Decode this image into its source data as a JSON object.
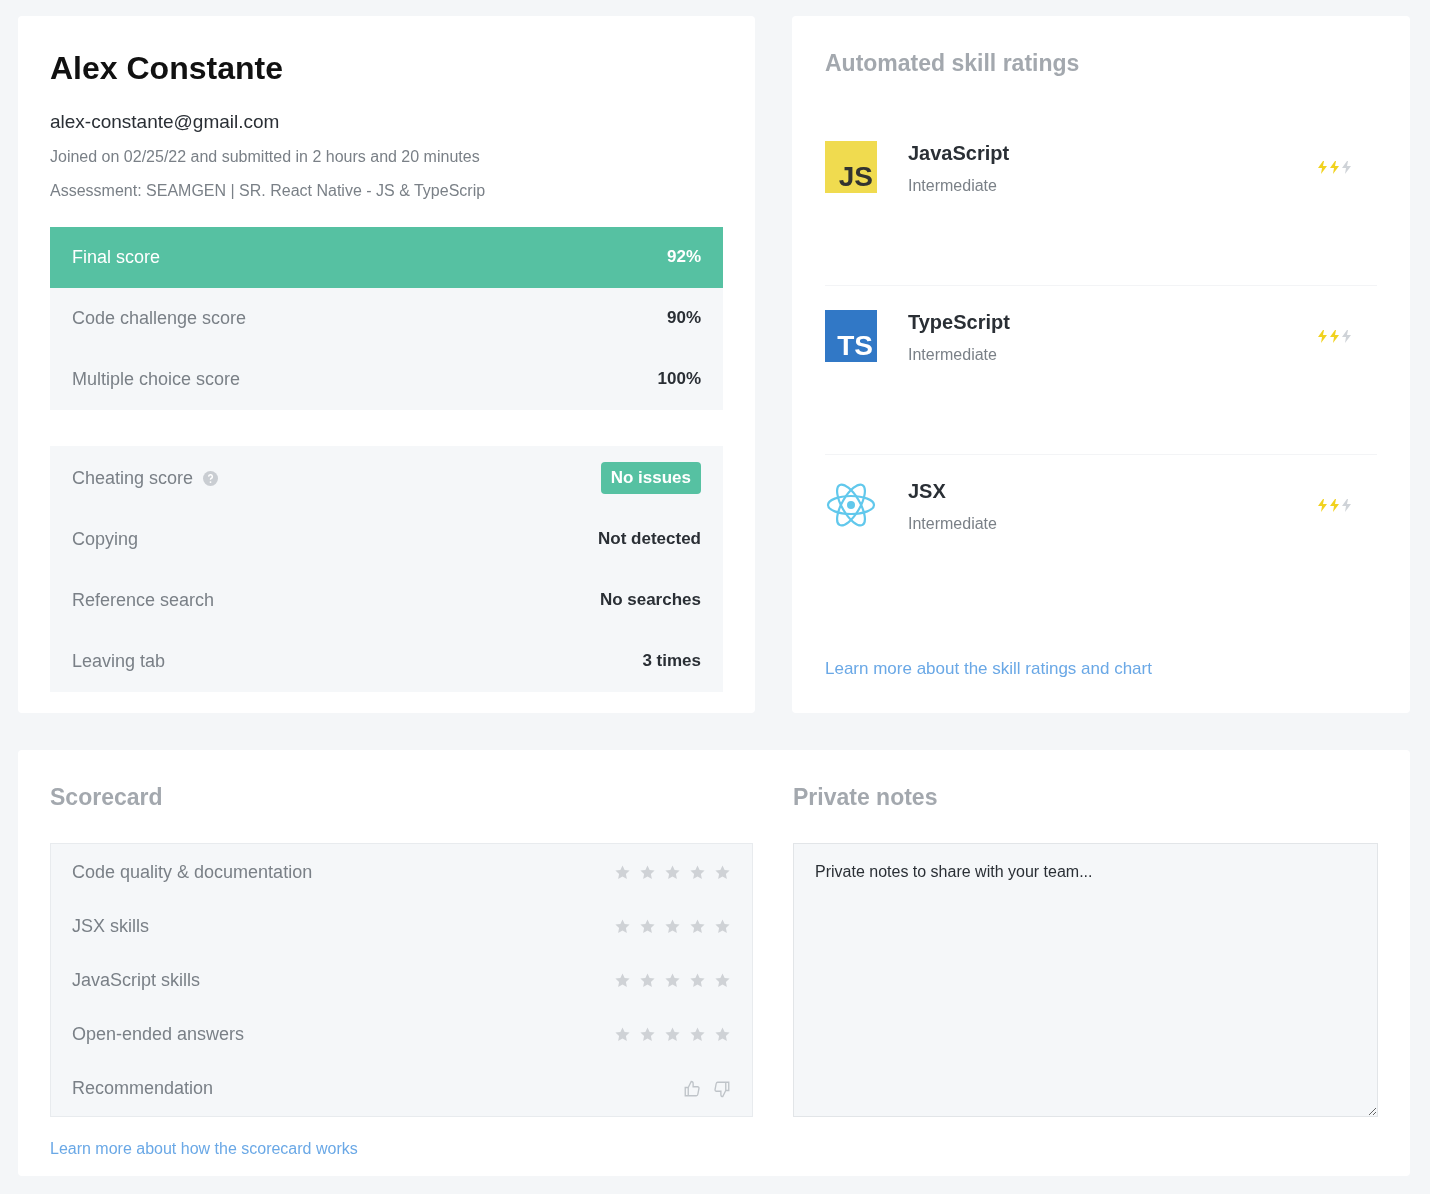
{
  "profile": {
    "name": "Alex Constante",
    "email": "alex-constante@gmail.com",
    "joined": "Joined on 02/25/22 and submitted in 2 hours and 20 minutes",
    "assessment": "Assessment: SEAMGEN | SR. React Native - JS & TypeScrip"
  },
  "scores": [
    {
      "label": "Final score",
      "value": "92%",
      "selected": true
    },
    {
      "label": "Code challenge score",
      "value": "90%",
      "selected": false
    },
    {
      "label": "Multiple choice score",
      "value": "100%",
      "selected": false
    }
  ],
  "cheating": {
    "label": "Cheating score",
    "badge": "No issues",
    "rows": [
      {
        "label": "Copying",
        "value": "Not detected"
      },
      {
        "label": "Reference search",
        "value": "No searches"
      },
      {
        "label": "Leaving tab",
        "value": "3 times"
      }
    ]
  },
  "skills": {
    "title": "Automated skill ratings",
    "items": [
      {
        "kind": "js",
        "logo": "JS",
        "name": "JavaScript",
        "level_text": "Intermediate",
        "stars": 2
      },
      {
        "kind": "ts",
        "logo": "TS",
        "name": "TypeScript",
        "level_text": "Intermediate",
        "stars": 2
      },
      {
        "kind": "react",
        "name": "JSX",
        "level_text": "Intermediate",
        "stars": 2
      }
    ],
    "link": "Learn more about the skill ratings and chart"
  },
  "scorecard": {
    "title": "Scorecard",
    "rows": [
      {
        "kind": "stars",
        "label": "Code quality & documentation",
        "stars": 0
      },
      {
        "kind": "stars",
        "label": "JSX skills",
        "stars": 0
      },
      {
        "kind": "stars",
        "label": "JavaScript skills",
        "stars": 0
      },
      {
        "kind": "stars",
        "label": "Open-ended answers",
        "stars": 0
      },
      {
        "kind": "thumbs",
        "label": "Recommendation"
      }
    ],
    "link": "Learn more about how the scorecard works"
  },
  "notes": {
    "title": "Private notes",
    "placeholder": "Private notes to share with your team..."
  }
}
